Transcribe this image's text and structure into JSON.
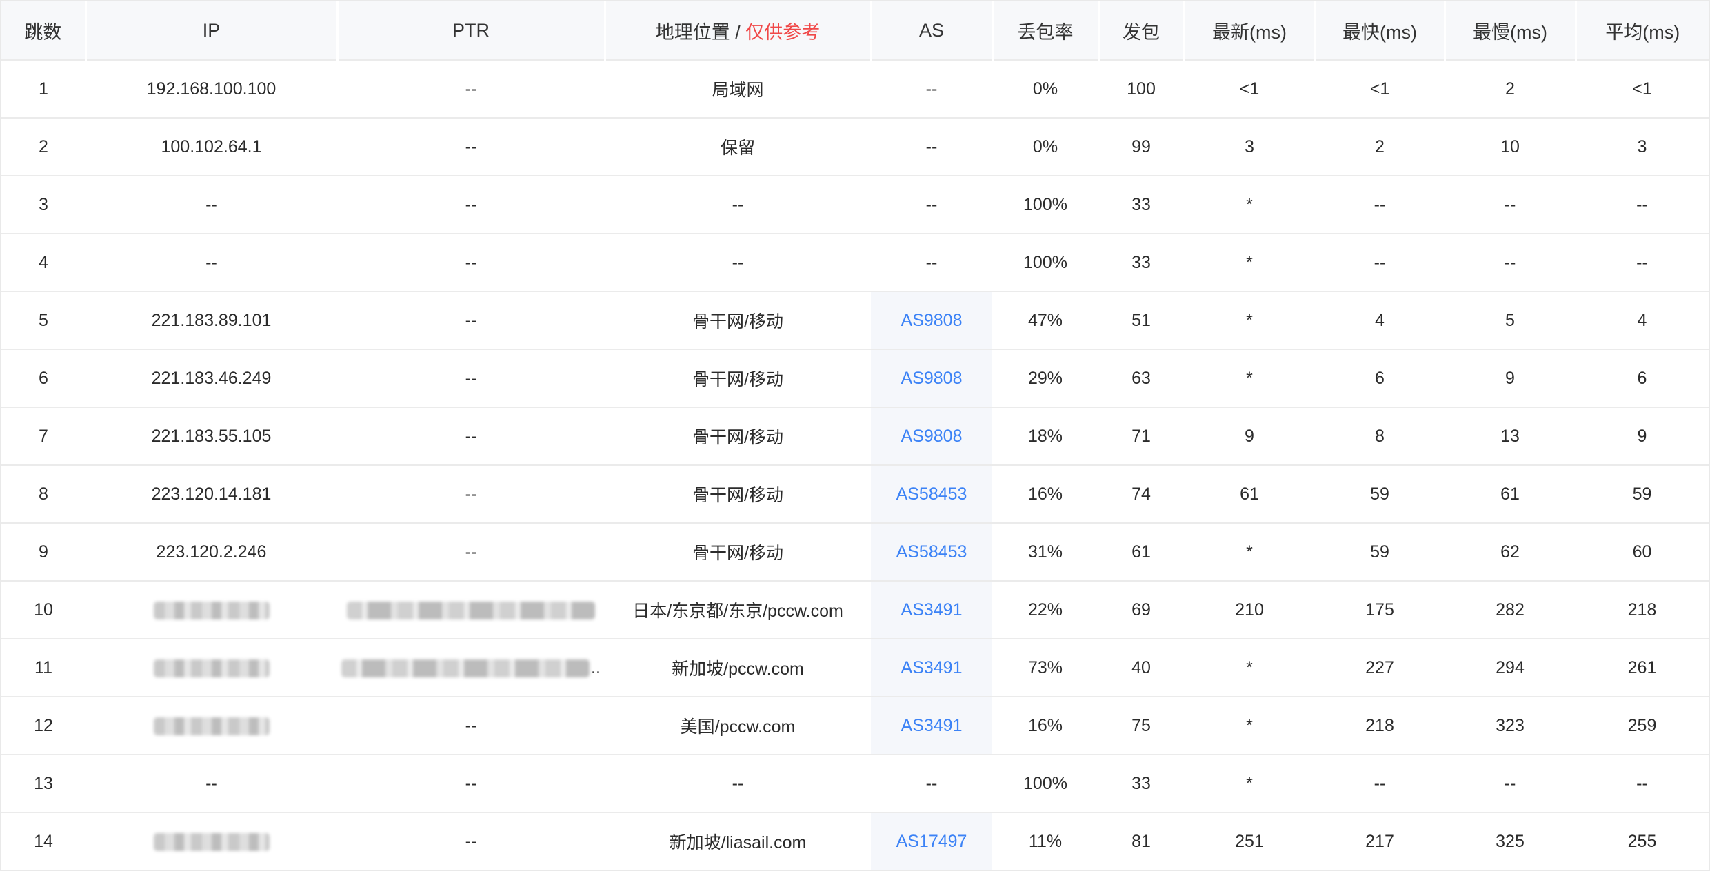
{
  "table": {
    "headers": {
      "hop": "跳数",
      "ip": "IP",
      "ptr": "PTR",
      "geo": "地理位置",
      "geo_sep": " / ",
      "geo_note": "仅供参考",
      "as": "AS",
      "loss": "丢包率",
      "sent": "发包",
      "last": "最新(ms)",
      "best": "最快(ms)",
      "worst": "最慢(ms)",
      "avg": "平均(ms)"
    },
    "rows": [
      {
        "hop": "1",
        "ip": "192.168.100.100",
        "ptr": "--",
        "geo": "局域网",
        "as": "--",
        "loss": "0%",
        "sent": "100",
        "last": "<1",
        "best": "<1",
        "worst": "2",
        "avg": "<1"
      },
      {
        "hop": "2",
        "ip": "100.102.64.1",
        "ptr": "--",
        "geo": "保留",
        "as": "--",
        "loss": "0%",
        "sent": "99",
        "last": "3",
        "best": "2",
        "worst": "10",
        "avg": "3"
      },
      {
        "hop": "3",
        "ip": "--",
        "ptr": "--",
        "geo": "--",
        "as": "--",
        "loss": "100%",
        "sent": "33",
        "last": "*",
        "best": "--",
        "worst": "--",
        "avg": "--"
      },
      {
        "hop": "4",
        "ip": "--",
        "ptr": "--",
        "geo": "--",
        "as": "--",
        "loss": "100%",
        "sent": "33",
        "last": "*",
        "best": "--",
        "worst": "--",
        "avg": "--"
      },
      {
        "hop": "5",
        "ip": "221.183.89.101",
        "ptr": "--",
        "geo": "骨干网/移动",
        "as": "AS9808",
        "loss": "47%",
        "sent": "51",
        "last": "*",
        "best": "4",
        "worst": "5",
        "avg": "4"
      },
      {
        "hop": "6",
        "ip": "221.183.46.249",
        "ptr": "--",
        "geo": "骨干网/移动",
        "as": "AS9808",
        "loss": "29%",
        "sent": "63",
        "last": "*",
        "best": "6",
        "worst": "9",
        "avg": "6"
      },
      {
        "hop": "7",
        "ip": "221.183.55.105",
        "ptr": "--",
        "geo": "骨干网/移动",
        "as": "AS9808",
        "loss": "18%",
        "sent": "71",
        "last": "9",
        "best": "8",
        "worst": "13",
        "avg": "9"
      },
      {
        "hop": "8",
        "ip": "223.120.14.181",
        "ptr": "--",
        "geo": "骨干网/移动",
        "as": "AS58453",
        "loss": "16%",
        "sent": "74",
        "last": "61",
        "best": "59",
        "worst": "61",
        "avg": "59"
      },
      {
        "hop": "9",
        "ip": "223.120.2.246",
        "ptr": "--",
        "geo": "骨干网/移动",
        "as": "AS58453",
        "loss": "31%",
        "sent": "61",
        "last": "*",
        "best": "59",
        "worst": "62",
        "avg": "60"
      },
      {
        "hop": "10",
        "ip": null,
        "ptr": null,
        "geo": "日本/东京都/东京/pccw.com",
        "as": "AS3491",
        "loss": "22%",
        "sent": "69",
        "last": "210",
        "best": "175",
        "worst": "282",
        "avg": "218"
      },
      {
        "hop": "11",
        "ip": null,
        "ptr": null,
        "ptr_ellipsis": "..",
        "geo": "新加坡/pccw.com",
        "as": "AS3491",
        "loss": "73%",
        "sent": "40",
        "last": "*",
        "best": "227",
        "worst": "294",
        "avg": "261"
      },
      {
        "hop": "12",
        "ip": null,
        "ptr": "--",
        "geo": "美国/pccw.com",
        "as": "AS3491",
        "loss": "16%",
        "sent": "75",
        "last": "*",
        "best": "218",
        "worst": "323",
        "avg": "259"
      },
      {
        "hop": "13",
        "ip": "--",
        "ptr": "--",
        "geo": "--",
        "as": "--",
        "loss": "100%",
        "sent": "33",
        "last": "*",
        "best": "--",
        "worst": "--",
        "avg": "--"
      },
      {
        "hop": "14",
        "ip": null,
        "ptr": "--",
        "geo": "新加坡/liasail.com",
        "as": "AS17497",
        "loss": "11%",
        "sent": "81",
        "last": "251",
        "best": "217",
        "worst": "325",
        "avg": "255"
      }
    ]
  },
  "colors": {
    "header_bg": "#f7f8fa",
    "as_link": "#3b82f6",
    "as_cell_bg": "#f5f7fb",
    "note_red": "#f04848",
    "border": "#ebebeb"
  }
}
